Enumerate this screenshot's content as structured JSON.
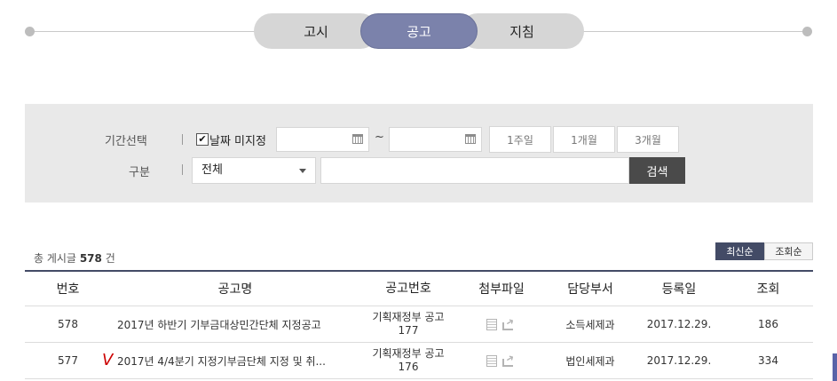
{
  "tabs": [
    {
      "label": "고시"
    },
    {
      "label": "공고"
    },
    {
      "label": "지침"
    }
  ],
  "filters": {
    "period_label": "기간선택",
    "no_date_label": "날짜 미지정",
    "no_date_checked": true,
    "range_sep": "~",
    "start_date": "",
    "end_date": "",
    "period_buttons": [
      "1주일",
      "1개월",
      "3개월"
    ],
    "category_label": "구분",
    "category_value": "전체",
    "keyword": "",
    "search_label": "검색"
  },
  "list": {
    "total_prefix": "총 게시글",
    "total_count": "578",
    "total_suffix": "건",
    "sort": [
      "최신순",
      "조회순"
    ],
    "columns": [
      "번호",
      "공고명",
      "공고번호",
      "첨부파일",
      "담당부서",
      "등록일",
      "조회"
    ],
    "rows": [
      {
        "no": "578",
        "title": "2017년 하반기 기부금대상민간단체 지정공고",
        "num_line1": "기획재정부 공고",
        "num_line2": "177",
        "dept": "소득세제과",
        "date": "2017.12.29.",
        "views": "186"
      },
      {
        "no": "577",
        "title": "2017년 4/4분기 지정기부금단체 지정 및 취...",
        "num_line1": "기획재정부 공고",
        "num_line2": "176",
        "dept": "법인세제과",
        "date": "2017.12.29.",
        "views": "334"
      }
    ],
    "annotation_mark": "V"
  },
  "colors": {
    "active_tab": "#7b82ab",
    "table_accent": "#434b66",
    "search_button": "#4a4a4a",
    "annotation": "#cc0000"
  }
}
